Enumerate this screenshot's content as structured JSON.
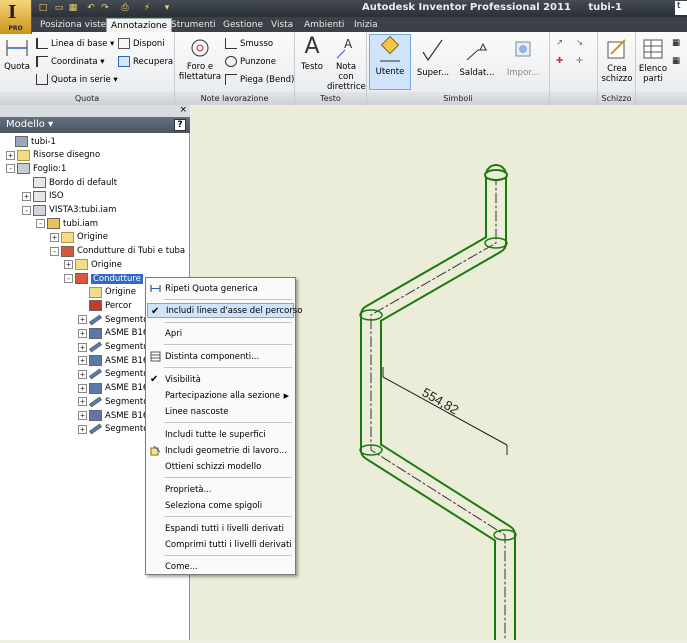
{
  "window": {
    "title": "Autodesk Inventor Professional 2011",
    "document": "tubi-1",
    "app_button_label": "PRO",
    "search_char": "t"
  },
  "tabs": [
    "Posiziona viste",
    "Annotazione",
    "Strumenti",
    "Gestione",
    "Vista",
    "Ambienti",
    "Inizia"
  ],
  "active_tab": "Annotazione",
  "ribbon": {
    "quota": {
      "title": "Quota",
      "big": "Quota",
      "items": [
        "Linea di base",
        "Coordinata",
        "Quota in serie",
        "Disponi",
        "Recupera"
      ]
    },
    "note": {
      "title": "Note lavorazione",
      "big": "Foro e filettatura",
      "items": [
        "Smusso",
        "Punzone",
        "Piega (Bend)"
      ]
    },
    "testo": {
      "title": "Testo",
      "items": [
        "Testo",
        "Nota con direttrice"
      ]
    },
    "simboli": {
      "title": "Simboli",
      "items": [
        "Utente",
        "Super...",
        "Saldat...",
        "Impor..."
      ]
    },
    "schizzo": {
      "title": "Schizzo",
      "items": [
        "Crea schizzo"
      ]
    },
    "tabella": {
      "items": [
        "Elenco parti"
      ]
    }
  },
  "browser": {
    "title": "Modello",
    "help": "?",
    "close": "×",
    "tree": [
      {
        "label": "tubi-1",
        "exp": ""
      },
      {
        "label": "Risorse disegno",
        "exp": "+"
      },
      {
        "label": "Foglio:1",
        "exp": "-"
      },
      {
        "label": "Bordo di default",
        "exp": ""
      },
      {
        "label": "ISO",
        "exp": "+"
      },
      {
        "label": "VISTA3:tubi.iam",
        "exp": "-"
      },
      {
        "label": "tubi.iam",
        "exp": "-"
      },
      {
        "label": "Origine",
        "exp": "+"
      },
      {
        "label": "Condutture di Tubi e tuba",
        "exp": "-"
      },
      {
        "label": "Origine",
        "exp": "+"
      },
      {
        "label": "Condutture",
        "exp": "-"
      },
      {
        "label": "Origine",
        "exp": ""
      },
      {
        "label": "Percor",
        "exp": ""
      },
      {
        "label": "Segmento",
        "exp": "+"
      },
      {
        "label": "ASME B16",
        "exp": "+"
      },
      {
        "label": "Segmento",
        "exp": "+"
      },
      {
        "label": "ASME B16",
        "exp": "+"
      },
      {
        "label": "Segmento",
        "exp": "+"
      },
      {
        "label": "ASME B16",
        "exp": "+"
      },
      {
        "label": "Segmento",
        "exp": "+"
      },
      {
        "label": "ASME B16",
        "exp": "+"
      },
      {
        "label": "Segmento",
        "exp": "+"
      }
    ]
  },
  "context_menu": {
    "items": [
      "Ripeti Quota generica",
      "Includi linee d'asse del percorso",
      "Apri",
      "Distinta componenti...",
      "Visibilità",
      "Partecipazione alla sezione",
      "Linee nascoste",
      "Includi tutte le superfici",
      "Includi geometrie di lavoro...",
      "Ottieni schizzi modello",
      "Proprietà...",
      "Seleziona come spigoli",
      "Espandi tutti i livelli derivati",
      "Comprimi tutti i livelli derivati",
      "Come..."
    ]
  },
  "drawing": {
    "dimension": "554,82",
    "line_color": "#1a7a0e"
  }
}
